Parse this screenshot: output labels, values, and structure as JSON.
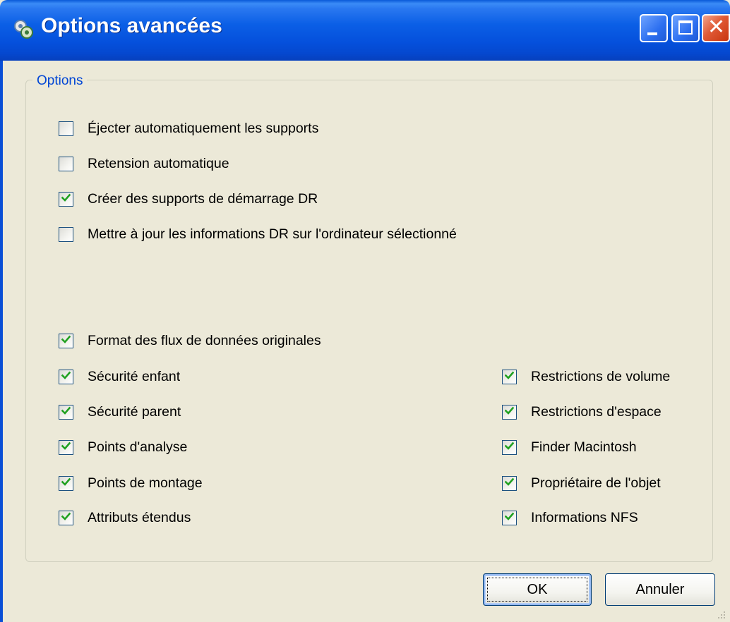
{
  "window": {
    "title": "Options avancées"
  },
  "group": {
    "legend": "Options"
  },
  "checkboxes_top": [
    {
      "label": "Éjecter automatiquement les supports",
      "checked": false
    },
    {
      "label": "Retension automatique",
      "checked": false
    },
    {
      "label": "Créer des supports de démarrage DR",
      "checked": true
    },
    {
      "label": "Mettre à jour les informations DR sur l'ordinateur sélectionné",
      "checked": false
    }
  ],
  "checkbox_format": {
    "label": "Format des flux de données originales",
    "checked": true
  },
  "checkboxes_left": [
    {
      "label": "Sécurité enfant",
      "checked": true
    },
    {
      "label": "Sécurité parent",
      "checked": true
    },
    {
      "label": "Points d'analyse",
      "checked": true
    },
    {
      "label": "Points de montage",
      "checked": true
    },
    {
      "label": "Attributs étendus",
      "checked": true
    }
  ],
  "checkboxes_right": [
    {
      "label": "Restrictions de volume",
      "checked": true
    },
    {
      "label": "Restrictions d'espace",
      "checked": true
    },
    {
      "label": "Finder Macintosh",
      "checked": true
    },
    {
      "label": "Propriétaire de l'objet",
      "checked": true
    },
    {
      "label": "Informations NFS",
      "checked": true
    }
  ],
  "buttons": {
    "ok": "OK",
    "cancel": "Annuler"
  },
  "colors": {
    "titlebar": "#0550dc",
    "legend": "#0046d5",
    "tick": "#21a121"
  }
}
